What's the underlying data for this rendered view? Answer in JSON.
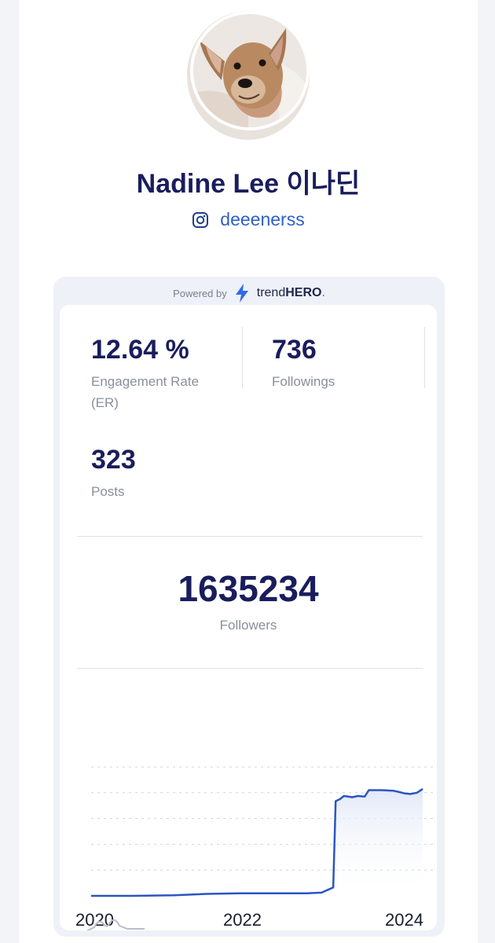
{
  "profile": {
    "name": "Nadine Lee 이나딘",
    "handle": "deeenerss",
    "platform_icon": "instagram-icon"
  },
  "powered": {
    "label": "Powered by",
    "brand_prefix": "trend",
    "brand_bold": "HERO",
    "brand_dot": "."
  },
  "stats": {
    "engagement_rate": {
      "value": "12.64 %",
      "label": "Engagement Rate (ER)"
    },
    "followings": {
      "value": "736",
      "label": "Followings"
    },
    "posts": {
      "value": "323",
      "label": "Posts"
    },
    "followers": {
      "value": "1635234",
      "label": "Followers"
    }
  },
  "chart_data": {
    "type": "area",
    "x_tick_labels": [
      "2020",
      "2022",
      "2024"
    ],
    "xlim": [
      2020.0,
      2024.0
    ],
    "ylim": [
      0,
      2000000
    ],
    "grid": "dashed horizontal",
    "series": [
      {
        "color": "#2b55c2",
        "x": [
          2020.0,
          2020.5,
          2021.0,
          2021.4,
          2021.8,
          2022.2,
          2022.6,
          2022.78,
          2022.92,
          2022.95,
          2023.0,
          2023.05,
          2023.15,
          2023.22,
          2023.3,
          2023.35,
          2023.5,
          2023.65,
          2023.72,
          2023.78,
          2023.85,
          2023.93,
          2024.0
        ],
        "y": [
          0,
          0,
          10000,
          30000,
          40000,
          40000,
          40000,
          50000,
          130000,
          1470000,
          1500000,
          1550000,
          1530000,
          1550000,
          1540000,
          1640000,
          1640000,
          1630000,
          1610000,
          1590000,
          1580000,
          1600000,
          1660000
        ]
      }
    ]
  },
  "colors": {
    "text_dark": "#1a1d5c",
    "link_blue": "#2f5fc4",
    "muted": "#8a8f9c",
    "line": "#2b55c2"
  }
}
